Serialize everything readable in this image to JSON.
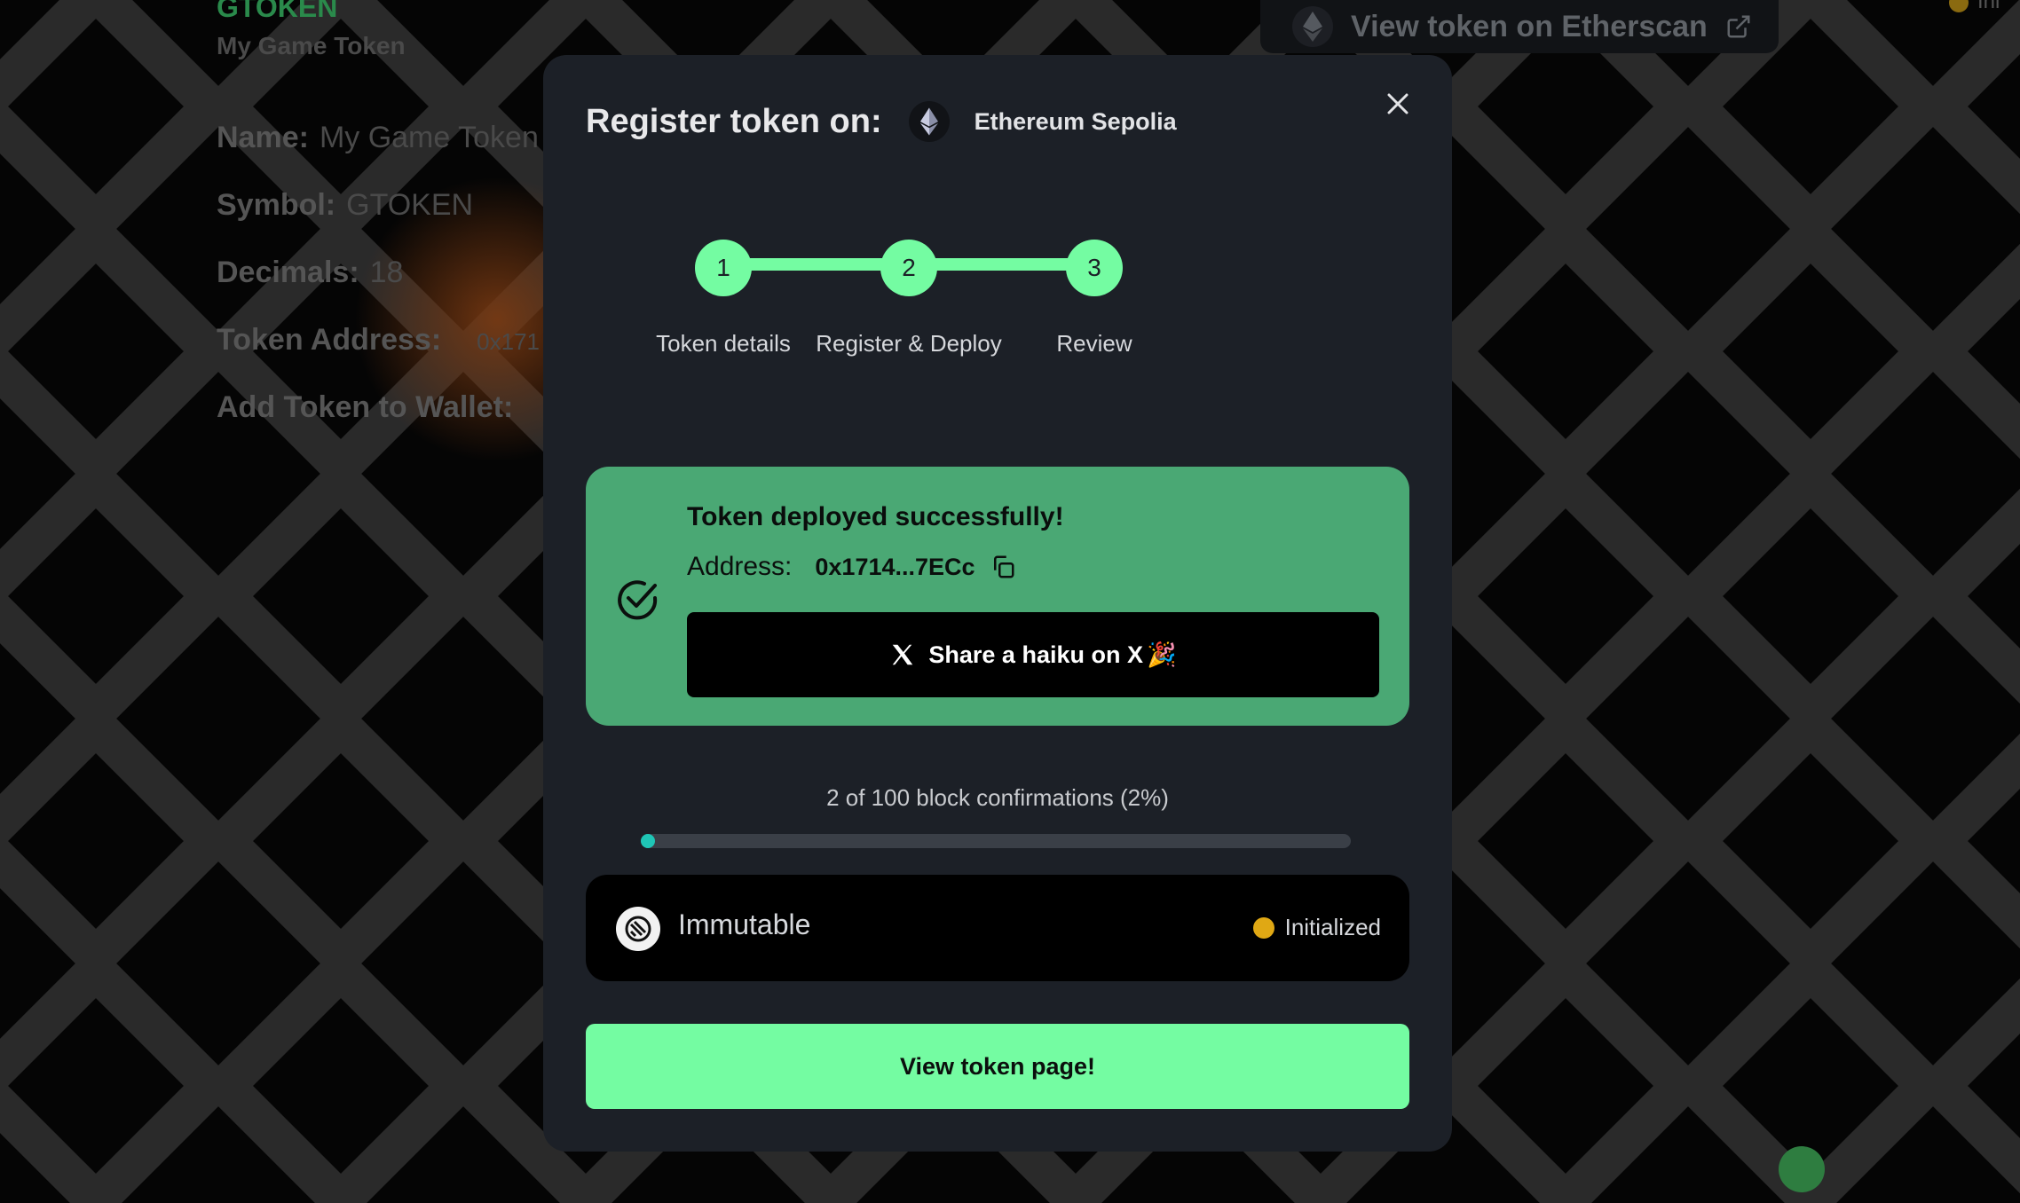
{
  "background": {
    "token_symbol": "GTOKEN",
    "token_title": "My Game Token",
    "fields": [
      {
        "label": "Name:",
        "value": "My Game Token"
      },
      {
        "label": "Symbol:",
        "value": "GTOKEN"
      },
      {
        "label": "Decimals:",
        "value": "18"
      },
      {
        "label": "Token Address:",
        "value": "0x171"
      },
      {
        "label": "Add Token to Wallet:",
        "value": ""
      }
    ],
    "etherscan_link": "View token on Etherscan",
    "corner_text": "Ini"
  },
  "modal": {
    "title": "Register token on:",
    "chain_name": "Ethereum Sepolia",
    "chain_icon": "ethereum-icon",
    "steps": [
      {
        "number": "1",
        "label": "Token details"
      },
      {
        "number": "2",
        "label": "Register & Deploy"
      },
      {
        "number": "3",
        "label": "Review"
      }
    ],
    "success": {
      "title": "Token deployed successfully!",
      "address_label": "Address:",
      "address_value": "0x1714...7ECc",
      "share_label": "Share a haiku on X",
      "share_emoji": "🎉"
    },
    "confirmations": {
      "text": "2 of 100 block confirmations (2%)",
      "current": 2,
      "total": 100
    },
    "provider": {
      "name": "Immutable",
      "status": "Initialized",
      "status_color": "#e0a814"
    },
    "view_button": "View token page!"
  },
  "colors": {
    "accent": "#74fca2",
    "success_bg": "#4aa874",
    "modal_bg": "#1c2027",
    "progress": "#1fc6b6"
  }
}
